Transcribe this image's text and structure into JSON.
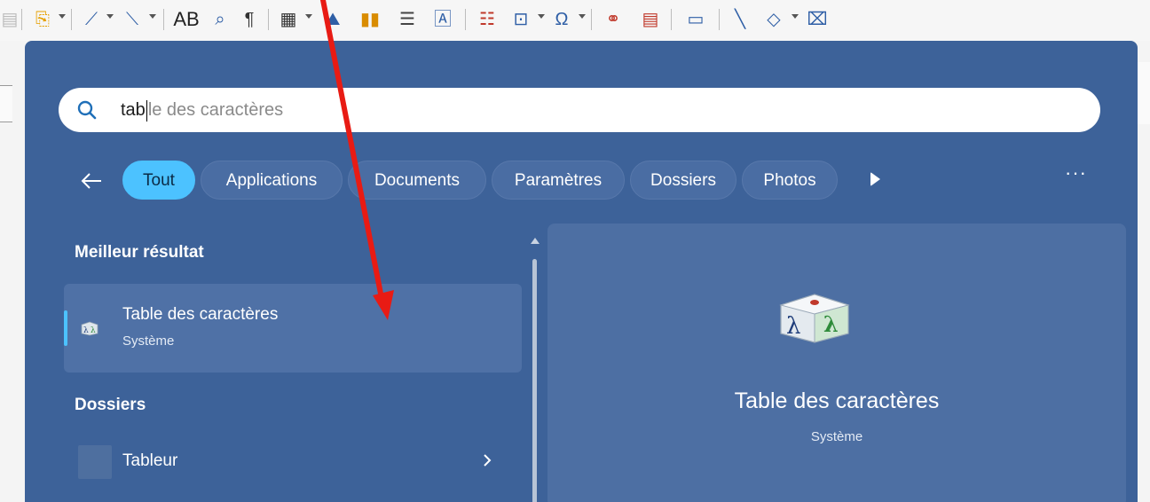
{
  "toolbar": {
    "items": [
      "document-icon",
      "new-page-icon",
      "line-icon",
      "arrow-line-icon",
      "spellcheck-text",
      "find-replace-icon",
      "pilcrow-icon",
      "table-icon",
      "image-icon",
      "chart-icon",
      "field-icon",
      "textbox-icon",
      "header-icon",
      "form-control-icon",
      "formula-icon",
      "hyperlink-icon",
      "footnote-icon",
      "comment-icon",
      "line-draw-icon",
      "shape-icon",
      "frame-icon"
    ],
    "spellcheck_label": "AB"
  },
  "search": {
    "query": "tab",
    "suggestion": "le des caractères"
  },
  "filters": {
    "tabs": [
      {
        "label": "Tout",
        "active": true
      },
      {
        "label": "Applications",
        "active": false
      },
      {
        "label": "Documents",
        "active": false
      },
      {
        "label": "Paramètres",
        "active": false
      },
      {
        "label": "Dossiers",
        "active": false
      },
      {
        "label": "Photos",
        "active": false
      }
    ],
    "more": "···"
  },
  "results": {
    "best_title": "Meilleur résultat",
    "best": {
      "name": "Table des caractères",
      "category": "Système"
    },
    "folders_title": "Dossiers",
    "folders": [
      {
        "name": "Tableur"
      }
    ]
  },
  "preview": {
    "name": "Table des caractères",
    "category": "Système"
  },
  "colors": {
    "panel": "#3d6299",
    "accent": "#4cc2ff",
    "annotation": "#e81b14"
  }
}
